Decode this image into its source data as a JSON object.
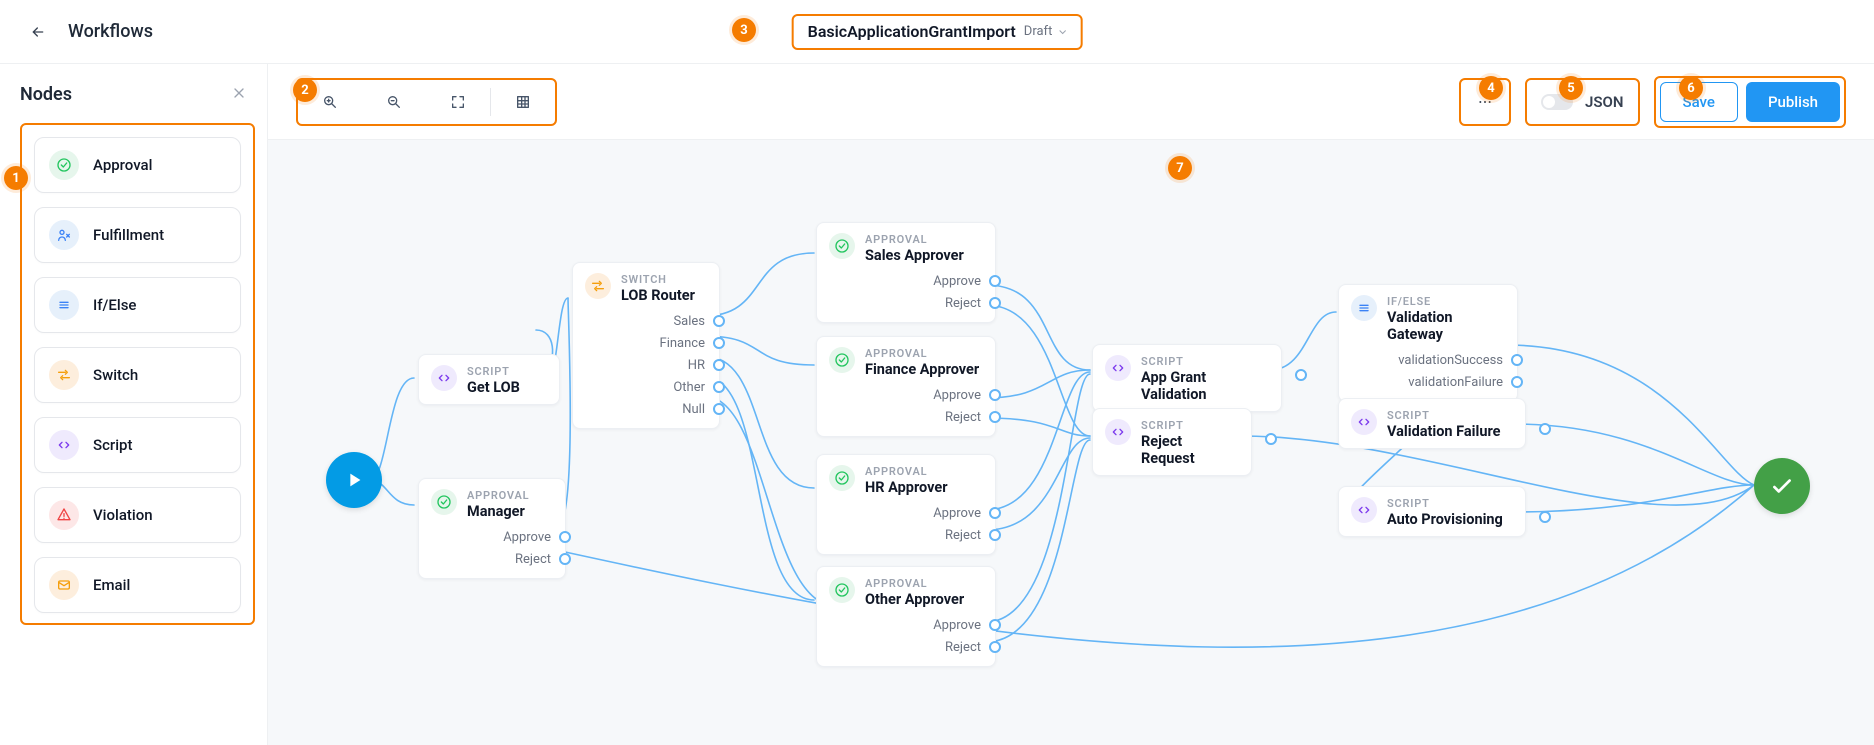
{
  "header": {
    "breadcrumb": "Workflows",
    "workflow_name": "BasicApplicationGrantImport",
    "workflow_status": "Draft"
  },
  "sidebar": {
    "title": "Nodes",
    "items": [
      {
        "label": "Approval",
        "icon": "approval"
      },
      {
        "label": "Fulfillment",
        "icon": "fulfillment"
      },
      {
        "label": "If/Else",
        "icon": "ifelse"
      },
      {
        "label": "Switch",
        "icon": "switch"
      },
      {
        "label": "Script",
        "icon": "script"
      },
      {
        "label": "Violation",
        "icon": "violation"
      },
      {
        "label": "Email",
        "icon": "email"
      }
    ]
  },
  "toolbar": {
    "json_label": "JSON",
    "save_label": "Save",
    "publish_label": "Publish"
  },
  "canvas": {
    "nodes": {
      "getlob": {
        "type": "SCRIPT",
        "name": "Get LOB"
      },
      "lobrouter": {
        "type": "SWITCH",
        "name": "LOB Router",
        "outputs": [
          "Sales",
          "Finance",
          "HR",
          "Other",
          "Null"
        ]
      },
      "manager": {
        "type": "APPROVAL",
        "name": "Manager",
        "outputs": [
          "Approve",
          "Reject"
        ]
      },
      "sales": {
        "type": "APPROVAL",
        "name": "Sales Approver",
        "outputs": [
          "Approve",
          "Reject"
        ]
      },
      "finance": {
        "type": "APPROVAL",
        "name": "Finance Approver",
        "outputs": [
          "Approve",
          "Reject"
        ]
      },
      "hr": {
        "type": "APPROVAL",
        "name": "HR Approver",
        "outputs": [
          "Approve",
          "Reject"
        ]
      },
      "other": {
        "type": "APPROVAL",
        "name": "Other Approver",
        "outputs": [
          "Approve",
          "Reject"
        ]
      },
      "appgrant": {
        "type": "SCRIPT",
        "name": "App Grant Validation"
      },
      "reject": {
        "type": "SCRIPT",
        "name": "Reject Request"
      },
      "gateway": {
        "type": "IF/ELSE",
        "name": "Validation Gateway",
        "outputs": [
          "validationSuccess",
          "validationFailure"
        ]
      },
      "valfail": {
        "type": "SCRIPT",
        "name": "Validation Failure"
      },
      "autoprov": {
        "type": "SCRIPT",
        "name": "Auto Provisioning"
      }
    }
  },
  "callouts": [
    "1",
    "2",
    "3",
    "4",
    "5",
    "6",
    "7"
  ]
}
